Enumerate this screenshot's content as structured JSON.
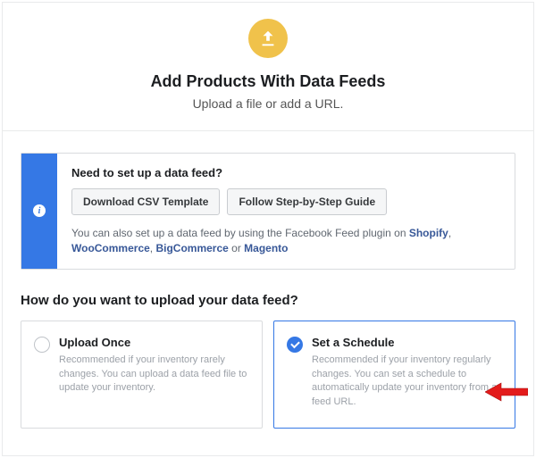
{
  "header": {
    "title": "Add Products With Data Feeds",
    "subtitle": "Upload a file or add a URL."
  },
  "infoBox": {
    "heading": "Need to set up a data feed?",
    "buttons": {
      "downloadCsv": "Download CSV Template",
      "guide": "Follow Step-by-Step Guide"
    },
    "helpPrefix": "You can also set up a data feed by using the Facebook Feed plugin on ",
    "links": {
      "shopify": "Shopify",
      "woocommerce": "WooCommerce",
      "bigcommerce": "BigCommerce",
      "magento": "Magento"
    },
    "sep": ", ",
    "or": " or "
  },
  "uploadQuestion": "How do you want to upload your data feed?",
  "options": {
    "uploadOnce": {
      "title": "Upload Once",
      "desc": "Recommended if your inventory rarely changes. You can upload a data feed file to update your inventory."
    },
    "schedule": {
      "title": "Set a Schedule",
      "desc": "Recommended if your inventory regularly changes. You can set a schedule to automatically update your inventory from a feed URL."
    }
  },
  "colors": {
    "accent": "#3578e5",
    "gold": "#f0c24b",
    "arrow": "#e31b1b"
  }
}
